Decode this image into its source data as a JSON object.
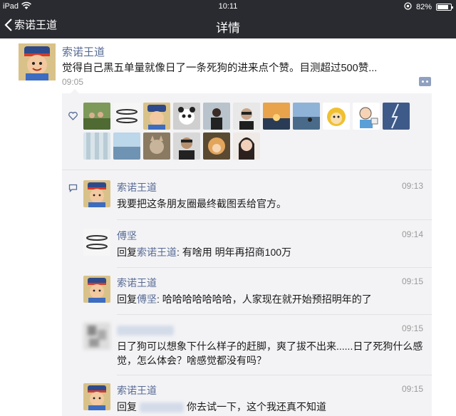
{
  "status": {
    "carrier": "iPad",
    "time": "10:11",
    "battery": "82%",
    "battery_level": 0.82
  },
  "nav": {
    "back_label": "索诺王道",
    "title": "详情"
  },
  "post": {
    "author": "索诺王道",
    "text": "觉得自己黑五单量就像日了一条死狗的进来点个赞。目测超过500赞...",
    "time": "09:05"
  },
  "likes": {
    "icon": "heart-outline-icon",
    "avatars": [
      "group-photo-avatar",
      "bracelet-avatar",
      "cartoon-avatar",
      "panda-avatar",
      "person-avatar",
      "selfie-avatar",
      "sunset-avatar",
      "lake-avatar",
      "monkey-cartoon-avatar",
      "cartoon-man-avatar",
      "lightning-avatar",
      "curtain-avatar",
      "sea-avatar",
      "cat-avatar",
      "man-portrait-avatar",
      "child-avatar",
      "woman-portrait-avatar"
    ]
  },
  "comments": [
    {
      "name": "索诺王道",
      "time": "09:13",
      "reply_label": "",
      "reply_to": "",
      "text": "我要把这条朋友圈最终截图丢给官方。"
    },
    {
      "name": "傅坚",
      "time": "09:14",
      "reply_label": "回复",
      "reply_to": "索诺王道",
      "text": ": 有啥用 明年再招商100万"
    },
    {
      "name": "索诺王道",
      "time": "09:15",
      "reply_label": "回复",
      "reply_to": "傅坚",
      "text": ": 哈哈哈哈哈哈哈，人家现在就开始预招明年的了"
    },
    {
      "name": "",
      "time": "09:15",
      "reply_label": "",
      "reply_to": "",
      "text": "日了狗可以想象下什么样子的赶脚，爽了拔不出来......日了死狗什么感觉，怎么体会？啥感觉都没有吗？"
    },
    {
      "name": "索诺王道",
      "time": "09:15",
      "reply_label": "回复",
      "reply_to": "",
      "text": "你去试一下，这个我还真不知道"
    }
  ],
  "colors": {
    "bar": "#2a2b30",
    "link": "#576b95",
    "panel": "#f3f3f5"
  }
}
